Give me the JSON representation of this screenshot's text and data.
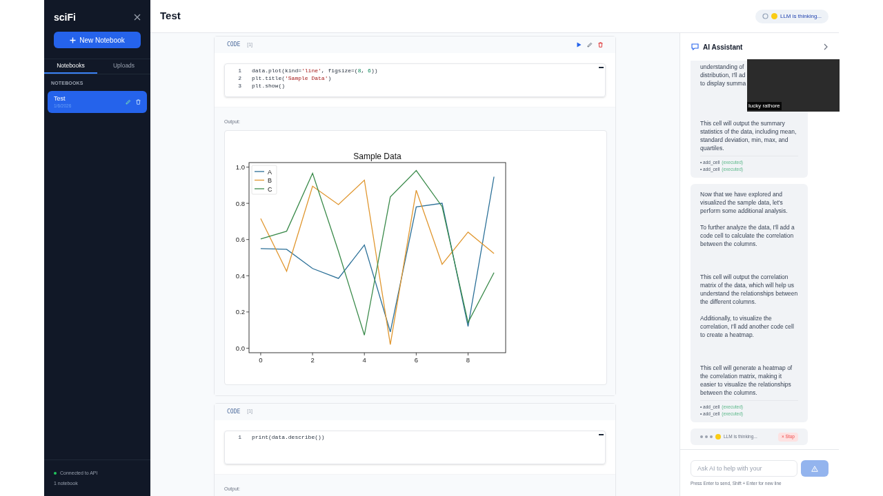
{
  "sidebar": {
    "title": "sciFi",
    "new_button": "New Notebook",
    "tabs": [
      {
        "label": "Notebooks",
        "selected": true
      },
      {
        "label": "Uploads",
        "selected": false
      }
    ],
    "section_label": "NOTEBOOKS",
    "notebooks": [
      {
        "name": "Test",
        "date": "1/6/2026",
        "selected": true
      }
    ],
    "connection": {
      "connected": true,
      "label": "Connected to API"
    },
    "count": "1 notebook"
  },
  "header": {
    "title": "Test",
    "status": "LLM is thinking..."
  },
  "cells": [
    {
      "type": "CODE",
      "execution_count": "[1]",
      "hovered": true,
      "lines": [
        {
          "number": "1",
          "tokens": [
            {
              "kind": "plain",
              "text": "data.plot(kind="
            },
            {
              "kind": "string",
              "text": "'line'"
            },
            {
              "kind": "plain",
              "text": ", figsize=("
            },
            {
              "kind": "number",
              "text": "8"
            },
            {
              "kind": "plain",
              "text": ", "
            },
            {
              "kind": "number",
              "text": "6"
            },
            {
              "kind": "plain",
              "text": "))"
            }
          ]
        },
        {
          "number": "2",
          "tokens": [
            {
              "kind": "plain",
              "text": "plt.title("
            },
            {
              "kind": "string",
              "text": "'Sample Data'"
            },
            {
              "kind": "plain",
              "text": ")"
            }
          ]
        },
        {
          "number": "3",
          "tokens": [
            {
              "kind": "plain",
              "text": "plt.show()"
            }
          ]
        }
      ],
      "output_label": "Output:",
      "chart_data": {
        "type": "line",
        "title": "Sample Data",
        "legend": "upper left",
        "x": [
          0,
          1,
          2,
          3,
          4,
          5,
          6,
          7,
          8,
          9
        ],
        "xlim": [
          -0.45,
          9.45
        ],
        "ylim": [
          -0.025,
          1.025
        ],
        "xticks": [
          0,
          2,
          4,
          6,
          8
        ],
        "yticks": [
          {
            "value": 0,
            "label": "0.0"
          },
          {
            "value": 0.2,
            "label": "0.2"
          },
          {
            "value": 0.4,
            "label": "0.4"
          },
          {
            "value": 0.6,
            "label": "0.6"
          },
          {
            "value": 0.8,
            "label": "0.8"
          },
          {
            "value": 1,
            "label": "1.0"
          }
        ],
        "series": [
          {
            "name": "A",
            "color": "#2a6f97",
            "values": [
              0.55,
              0.546,
              0.44,
              0.385,
              0.57,
              0.09,
              0.78,
              0.8,
              0.12,
              0.947
            ]
          },
          {
            "name": "B",
            "color": "#e0962e",
            "values": [
              0.716,
              0.425,
              0.895,
              0.793,
              0.928,
              0.02,
              0.872,
              0.463,
              0.641,
              0.523
            ]
          },
          {
            "name": "C",
            "color": "#3a8a4a",
            "values": [
              0.603,
              0.646,
              0.966,
              0.535,
              0.072,
              0.835,
              0.981,
              0.782,
              0.142,
              0.417
            ]
          }
        ]
      }
    },
    {
      "type": "CODE",
      "execution_count": "[1]",
      "hovered": false,
      "lines": [
        {
          "number": "1",
          "tokens": [
            {
              "kind": "plain",
              "text": "print(data.describe())"
            }
          ]
        }
      ],
      "output_label": "Output:"
    }
  ],
  "assistant": {
    "title": "AI Assistant",
    "messages": [
      {
        "paragraphs": [
          "understanding of\ndistribution, I'll ad\nto display summa",
          "This cell will output the summary statistics of the data, including mean, standard deviation, min, max, and quartiles."
        ],
        "tools": [
          {
            "name": "• add_cell",
            "status": "(executed)"
          },
          {
            "name": "• add_cell",
            "status": "(executed)"
          }
        ]
      },
      {
        "paragraphs": [
          "Now that we have explored and visualized the sample data, let's perform some additional analysis.",
          "To further analyze the data, I'll add a code cell to calculate the correlation between the columns.",
          "This cell will output the correlation matrix of the data, which will help us understand the relationships between the different columns.",
          "Additionally, to visualize the correlation, I'll add another code cell to create a heatmap.",
          "This cell will generate a heatmap of the correlation matrix, making it easier to visualize the relationships between the columns."
        ],
        "tools": [
          {
            "name": "• add_cell",
            "status": "(executed)"
          },
          {
            "name": "• add_cell",
            "status": "(executed)"
          }
        ]
      }
    ],
    "thinking": {
      "label": "LLM is thinking...",
      "stop": "× Stop"
    },
    "input": {
      "placeholder": "Ask AI to help with your"
    },
    "hint": "Press Enter to send, Shift + Enter for new line",
    "video_overlay": {
      "name_label": "lucky rathore"
    }
  }
}
